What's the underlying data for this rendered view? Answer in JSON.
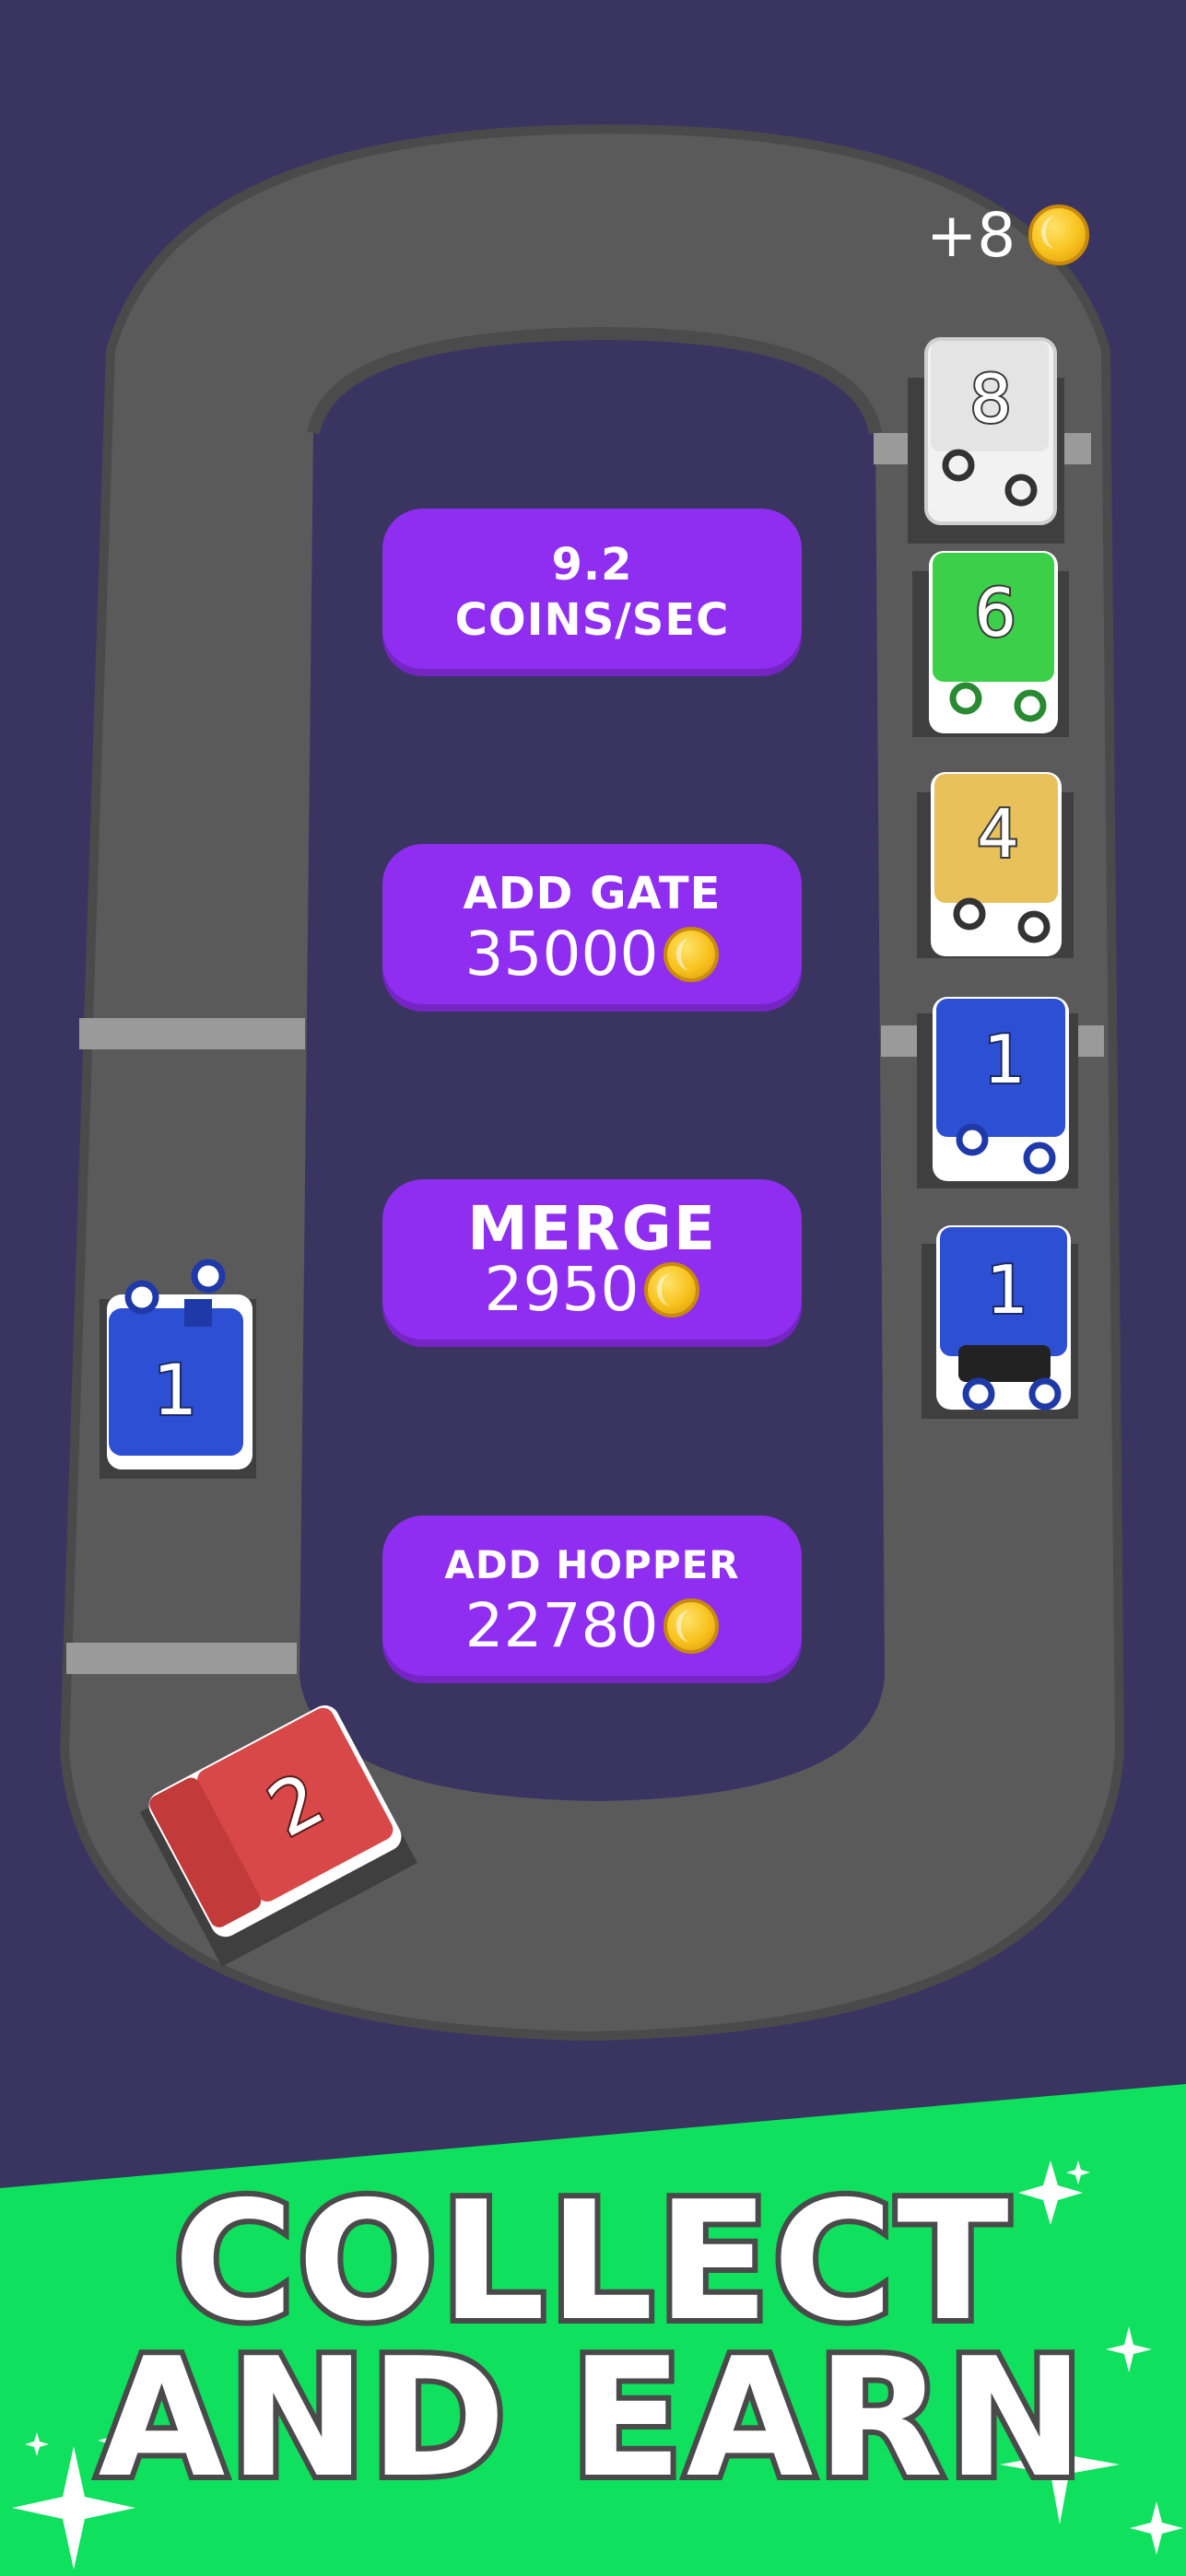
{
  "colors": {
    "background": "#3a3461",
    "track": "#5a5a5a",
    "button": "#8f2ef0",
    "banner": "#0fe05d",
    "car_blue": "#2d4fd4",
    "car_red": "#d94848",
    "car_green": "#3ccf4a",
    "car_yellow": "#e9c15a",
    "car_white": "#e8e8e8"
  },
  "coin_popup": {
    "text": "+8",
    "icon": "coin-icon"
  },
  "buttons": {
    "rate": {
      "value": "9.2",
      "unit": "COINS/SEC"
    },
    "add_gate": {
      "label": "ADD GATE",
      "cost": "35000",
      "icon": "coin-icon"
    },
    "merge": {
      "label": "MERGE",
      "cost": "2950",
      "icon": "coin-icon"
    },
    "add_hopper": {
      "label": "ADD HOPPER",
      "cost": "22780",
      "icon": "coin-icon"
    }
  },
  "cars": [
    {
      "level": "8",
      "color": "white"
    },
    {
      "level": "6",
      "color": "green"
    },
    {
      "level": "4",
      "color": "yellow"
    },
    {
      "level": "1",
      "color": "blue"
    },
    {
      "level": "1",
      "color": "blue"
    },
    {
      "level": "1",
      "color": "blue"
    },
    {
      "level": "2",
      "color": "red"
    }
  ],
  "banner": {
    "line1": "COLLECT",
    "line2": "AND EARN"
  }
}
